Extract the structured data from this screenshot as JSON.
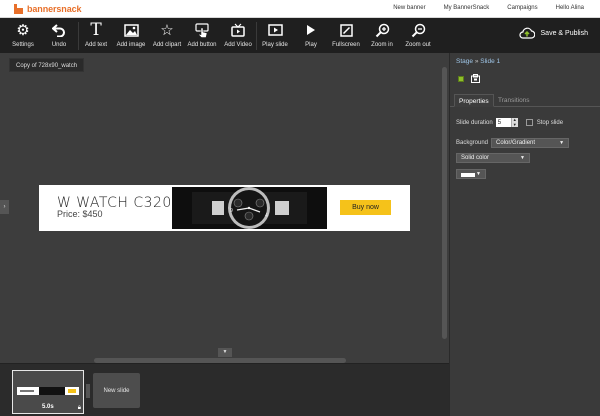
{
  "app": {
    "logo_text": "bannersnack"
  },
  "topnav": {
    "links": [
      "New banner",
      "My BannerSnack",
      "Campaigns",
      "Hello Alina"
    ]
  },
  "toolbar": {
    "items": [
      {
        "label": "Settings",
        "icon": "gear-icon"
      },
      {
        "label": "Undo",
        "icon": "undo-icon"
      },
      {
        "label": "Add text",
        "icon": "text-icon"
      },
      {
        "label": "Add image",
        "icon": "image-icon"
      },
      {
        "label": "Add clipart",
        "icon": "star-icon"
      },
      {
        "label": "Add button",
        "icon": "hand-pointer-icon"
      },
      {
        "label": "Add Video",
        "icon": "tv-icon"
      },
      {
        "label": "Play slide",
        "icon": "play-slide-icon"
      },
      {
        "label": "Play",
        "icon": "play-icon"
      },
      {
        "label": "Fullscreen",
        "icon": "fullscreen-icon"
      },
      {
        "label": "Zoom in",
        "icon": "zoom-in-icon"
      },
      {
        "label": "Zoom out",
        "icon": "zoom-out-icon"
      }
    ],
    "publish_label": "Save & Publish"
  },
  "canvas": {
    "filename": "Copy of 728x90_watch",
    "banner": {
      "title": "W WATCH C320",
      "price": "Price: $450",
      "cta": "Buy now"
    }
  },
  "filmstrip": {
    "slide_duration_label": "5.0s",
    "new_slide_label": "New slide"
  },
  "panel": {
    "breadcrumb": {
      "stage": "Stage",
      "separator": "»",
      "slide": "Slide 1"
    },
    "tabs": {
      "properties": "Properties",
      "transitions": "Transitions"
    },
    "slide_duration_label": "Slide duration",
    "slide_duration_value": "5",
    "stop_slide_label": "Stop slide",
    "background_label": "Background",
    "background_type": "Color/Gradient",
    "fill_type": "Solid color"
  },
  "colors": {
    "accent_orange": "#e8702a",
    "cta_yellow": "#f5c21a",
    "link_blue": "#9fc6e8",
    "add_green": "#8fbf2a"
  }
}
